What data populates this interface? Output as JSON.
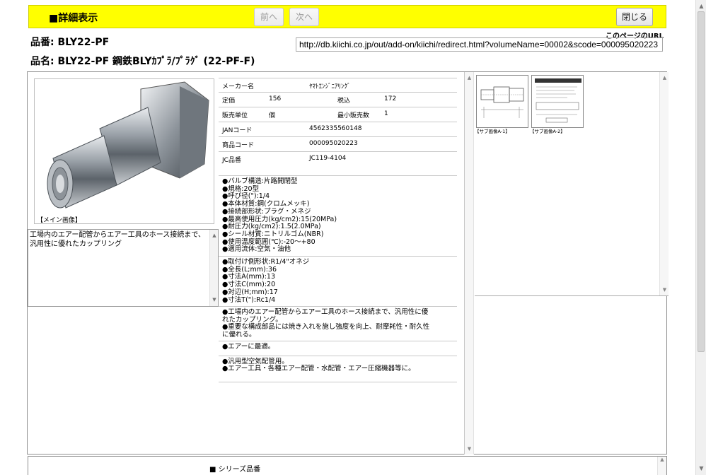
{
  "header": {
    "title": "■詳細表示",
    "prev_label": "前へ",
    "next_label": "次へ",
    "close_label": "閉じる"
  },
  "product": {
    "code_line": "品番: BLY22-PF",
    "name_line": "品名: BLY22-PF 鋼鉄BLYｶﾌﾟﾗ/ﾌﾟﾗｸﾞ (22-PF-F)"
  },
  "page_url": {
    "caption": "このページのURL",
    "value": "http://db.kiichi.co.jp/out/add-on/kiichi/redirect.html?volumeName=00002&scode=000095020223"
  },
  "main_image": {
    "caption": "【メイン画像】"
  },
  "description": "工場内のエアー配管からエアー工具のホース接続まで、汎用性に優れたカップリング",
  "specs": {
    "maker_label": "メーカー名",
    "maker_value": "ﾔﾏﾄｴﾝｼﾞﾆｱﾘﾝｸﾞ",
    "price_label": "定価",
    "price_value": "156",
    "tax_label": "税込",
    "tax_value": "172",
    "unit_label": "販売単位",
    "unit_value": "個",
    "min_label": "最小販売数",
    "min_value": "1",
    "jan_label": "JANコード",
    "jan_value": "4562335560148",
    "item_label": "商品コード",
    "item_value": "000095020223",
    "jc_label": "JC品番",
    "jc_value": "JC119-4104"
  },
  "features": {
    "block1": [
      "●バルブ構造:片路開閉型",
      "●規格:20型",
      "●呼び径(\"):1/4",
      "●本体材質:鋼(クロムメッキ)",
      "●接続部形状:プラグ・メネジ",
      "●最高使用圧力(kg/cm2):15(20MPa)",
      "●耐圧力(kg/cm2):1.5(2.0MPa)",
      "●シール材質:ニトリルゴム(NBR)",
      "●使用温度範囲(℃):-20～+80",
      "●適用流体:空気・油他"
    ],
    "block2": [
      "●取付け側形状:R1/4\"オネジ",
      "●全長(L;mm):36",
      "●寸法A(mm):13",
      "●寸法C(mm):20",
      "●対辺(H;mm):17",
      "●寸法T(\"):Rc1/4"
    ],
    "block3": [
      "●工場内のエアー配管からエアー工具のホース接続まで、汎用性に優",
      "れたカップリング。",
      "●重要な構成部品には焼き入れを施し強度を向上、耐摩耗性・耐久性",
      "に優れる。"
    ],
    "block4": [
      "●エアーに最適。"
    ],
    "block5": [
      "●汎用型空気配管用。",
      "●エアー工具・各種エアー配管・水配管・エアー圧縮機器等に。"
    ]
  },
  "sub_images": [
    {
      "caption": "【サブ画像A-1】"
    },
    {
      "caption": "【サブ画像A-2】"
    }
  ],
  "series": {
    "label": "■ シリーズ品番"
  }
}
